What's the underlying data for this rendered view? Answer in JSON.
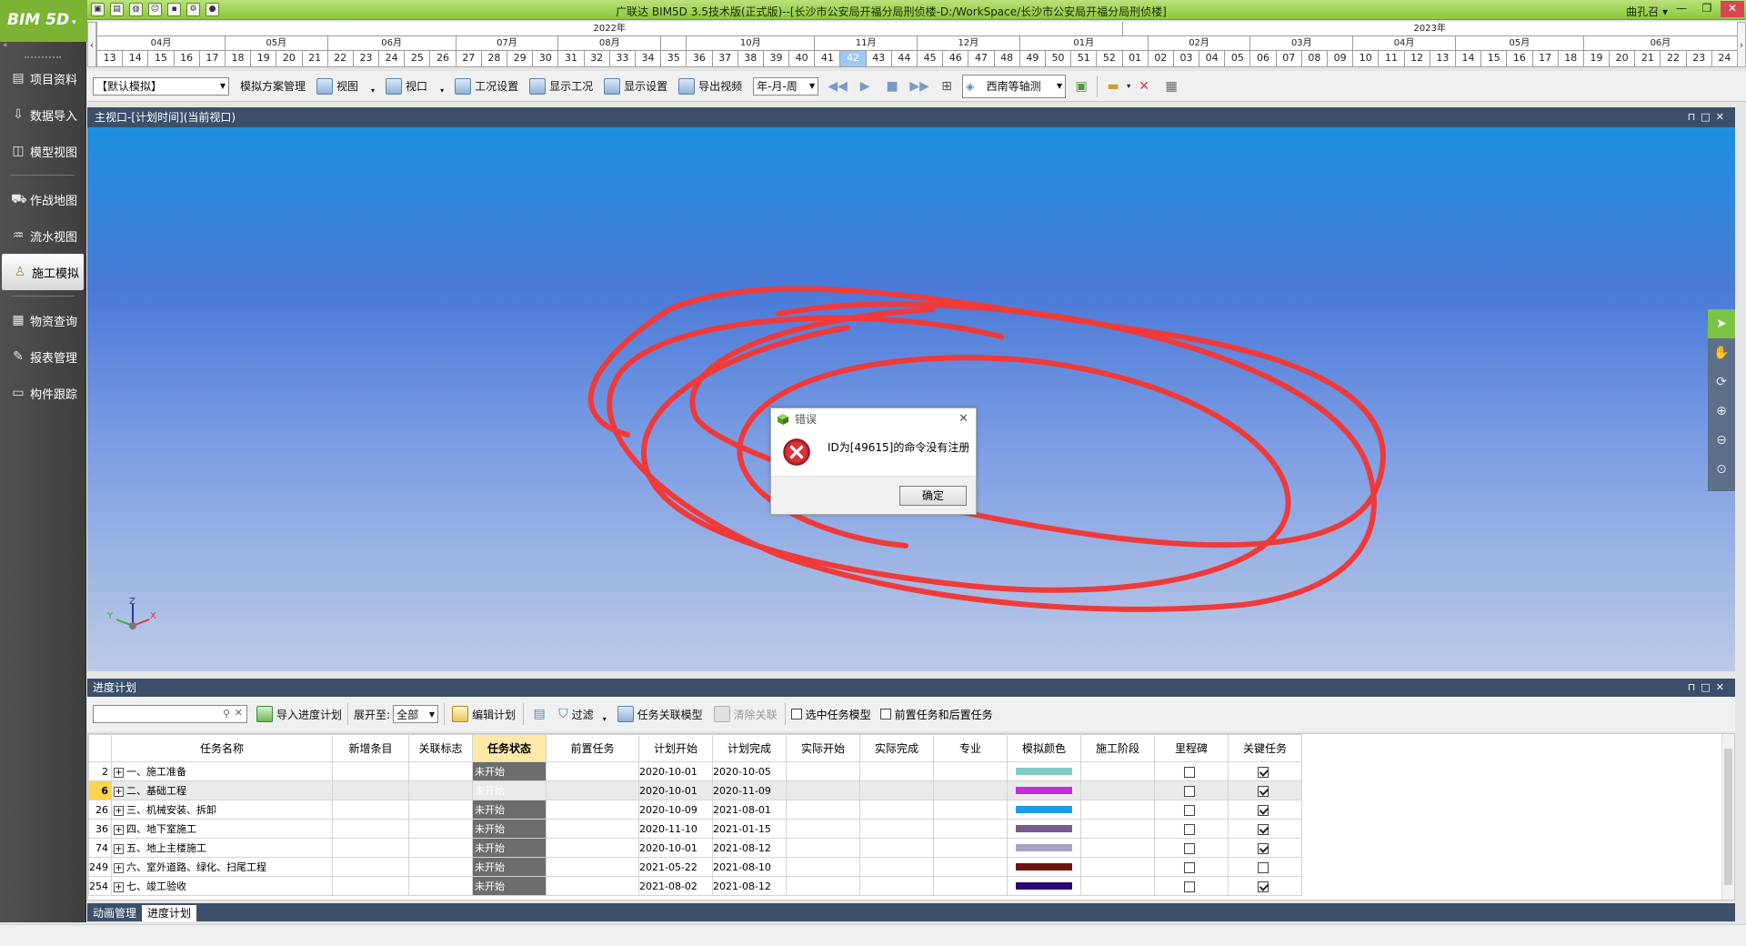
{
  "app": {
    "logo": "BIM 5D",
    "title": "广联达 BIM5D 3.5技术版(正式版)--[长沙市公安局开福分局刑侦楼-D:/WorkSpace/长沙市公安局开福分局刑侦楼]",
    "user": "曲孔召"
  },
  "sidebar": {
    "items": [
      {
        "label": "项目资料",
        "icon": "folder-icon"
      },
      {
        "label": "数据导入",
        "icon": "import-icon"
      },
      {
        "label": "模型视图",
        "icon": "model-icon"
      },
      {
        "label": "作战地图",
        "icon": "map-icon"
      },
      {
        "label": "流水视图",
        "icon": "flow-icon"
      },
      {
        "label": "施工模拟",
        "icon": "worker-icon"
      },
      {
        "label": "物资查询",
        "icon": "material-icon"
      },
      {
        "label": "报表管理",
        "icon": "report-icon"
      },
      {
        "label": "构件跟踪",
        "icon": "track-icon"
      }
    ],
    "active_index": 5
  },
  "timeline": {
    "years": [
      {
        "label": "2022年",
        "start": 0,
        "span": 40
      },
      {
        "label": "2023年",
        "start": 40,
        "span": 24
      }
    ],
    "months": [
      {
        "label": "04月",
        "start": 0,
        "span": 5
      },
      {
        "label": "05月",
        "start": 5,
        "span": 4
      },
      {
        "label": "06月",
        "start": 9,
        "span": 5
      },
      {
        "label": "07月",
        "start": 14,
        "span": 4
      },
      {
        "label": "08月",
        "start": 18,
        "span": 4
      },
      {
        "label": "",
        "start": 22,
        "span": 1
      },
      {
        "label": "10月",
        "start": 23,
        "span": 5
      },
      {
        "label": "11月",
        "start": 28,
        "span": 4
      },
      {
        "label": "12月",
        "start": 32,
        "span": 4
      },
      {
        "label": "01月",
        "start": 36,
        "span": 5
      },
      {
        "label": "02月",
        "start": 41,
        "span": 4
      },
      {
        "label": "03月",
        "start": 45,
        "span": 4
      },
      {
        "label": "04月",
        "start": 49,
        "span": 4
      },
      {
        "label": "05月",
        "start": 53,
        "span": 5
      },
      {
        "label": "06月",
        "start": 58,
        "span": 6
      }
    ],
    "weeks": [
      "13",
      "14",
      "15",
      "16",
      "17",
      "18",
      "19",
      "20",
      "21",
      "22",
      "23",
      "24",
      "25",
      "26",
      "27",
      "28",
      "29",
      "30",
      "31",
      "32",
      "33",
      "34",
      "35",
      "36",
      "37",
      "38",
      "39",
      "40",
      "41",
      "42",
      "43",
      "44",
      "45",
      "46",
      "47",
      "48",
      "49",
      "50",
      "51",
      "52",
      "01",
      "02",
      "03",
      "04",
      "05",
      "06",
      "07",
      "08",
      "09",
      "10",
      "11",
      "12",
      "13",
      "14",
      "15",
      "16",
      "17",
      "18",
      "19",
      "20",
      "21",
      "22",
      "23",
      "24"
    ],
    "current_week_index": 29
  },
  "toolbar": {
    "scheme": "【默认模拟】",
    "items": [
      {
        "label": "模拟方案管理",
        "icon": ""
      },
      {
        "label": "视图",
        "icon": "monitor-icon"
      },
      {
        "label": "视口",
        "icon": "monitor-icon"
      },
      {
        "label": "工况设置",
        "icon": "settings-icon"
      },
      {
        "label": "显示工况",
        "icon": "display-icon"
      },
      {
        "label": "显示设置",
        "icon": "display-settings-icon"
      },
      {
        "label": "导出视频",
        "icon": "video-icon"
      }
    ],
    "time_unit": "年-月-周",
    "view_direction": "西南等轴测"
  },
  "viewport": {
    "header": "主视口-[计划时间](当前视口)",
    "annotation_color": "#f03a3a",
    "gradient_top": "#1c8fdc",
    "gradient_bottom": "#bccbe6"
  },
  "dialog": {
    "title": "错误",
    "message": "ID为[49615]的命令没有注册",
    "ok": "确定"
  },
  "schedule": {
    "header": "进度计划",
    "search_placeholder": "",
    "import_label": "导入进度计划",
    "expand_label": "展开至:",
    "expand_value": "全部",
    "edit_label": "编辑计划",
    "filter_label": "过滤",
    "link_label": "任务关联模型",
    "clear_label": "清除关联",
    "check_selected": "选中任务模型",
    "check_prepost": "前置任务和后置任务",
    "columns": [
      "",
      "任务名称",
      "新增条目",
      "关联标志",
      "任务状态",
      "前置任务",
      "计划开始",
      "计划完成",
      "实际开始",
      "实际完成",
      "专业",
      "模拟颜色",
      "施工阶段",
      "里程碑",
      "关键任务"
    ],
    "rows": [
      {
        "id": "2",
        "name": "一、施工准备",
        "status": "未开始",
        "start": "2020-10-01",
        "end": "2020-10-05",
        "color": "#7fcdc6",
        "milestone": false,
        "critical": true
      },
      {
        "id": "6",
        "name": "二、基础工程",
        "status": "未开始",
        "start": "2020-10-01",
        "end": "2020-11-09",
        "color": "#c02ed8",
        "milestone": false,
        "critical": true
      },
      {
        "id": "26",
        "name": "三、机械安装、拆卸",
        "status": "未开始",
        "start": "2020-10-09",
        "end": "2021-08-01",
        "color": "#1e9be8",
        "milestone": false,
        "critical": true
      },
      {
        "id": "36",
        "name": "四、地下室施工",
        "status": "未开始",
        "start": "2020-11-10",
        "end": "2021-01-15",
        "color": "#7b5a8e",
        "milestone": false,
        "critical": true
      },
      {
        "id": "74",
        "name": "五、地上主楼施工",
        "status": "未开始",
        "start": "2020-10-01",
        "end": "2021-08-12",
        "color": "#a8a2c4",
        "milestone": false,
        "critical": true
      },
      {
        "id": "249",
        "name": "六、室外道路、绿化、扫尾工程",
        "status": "未开始",
        "start": "2021-05-22",
        "end": "2021-08-10",
        "color": "#6e1212",
        "milestone": false,
        "critical": false
      },
      {
        "id": "254",
        "name": "七、竣工验收",
        "status": "未开始",
        "start": "2021-08-02",
        "end": "2021-08-12",
        "color": "#2a0a6e",
        "milestone": false,
        "critical": true
      }
    ],
    "selected_row": 1
  },
  "bottom_tabs": [
    "动画管理",
    "进度计划"
  ],
  "active_tab": 1
}
